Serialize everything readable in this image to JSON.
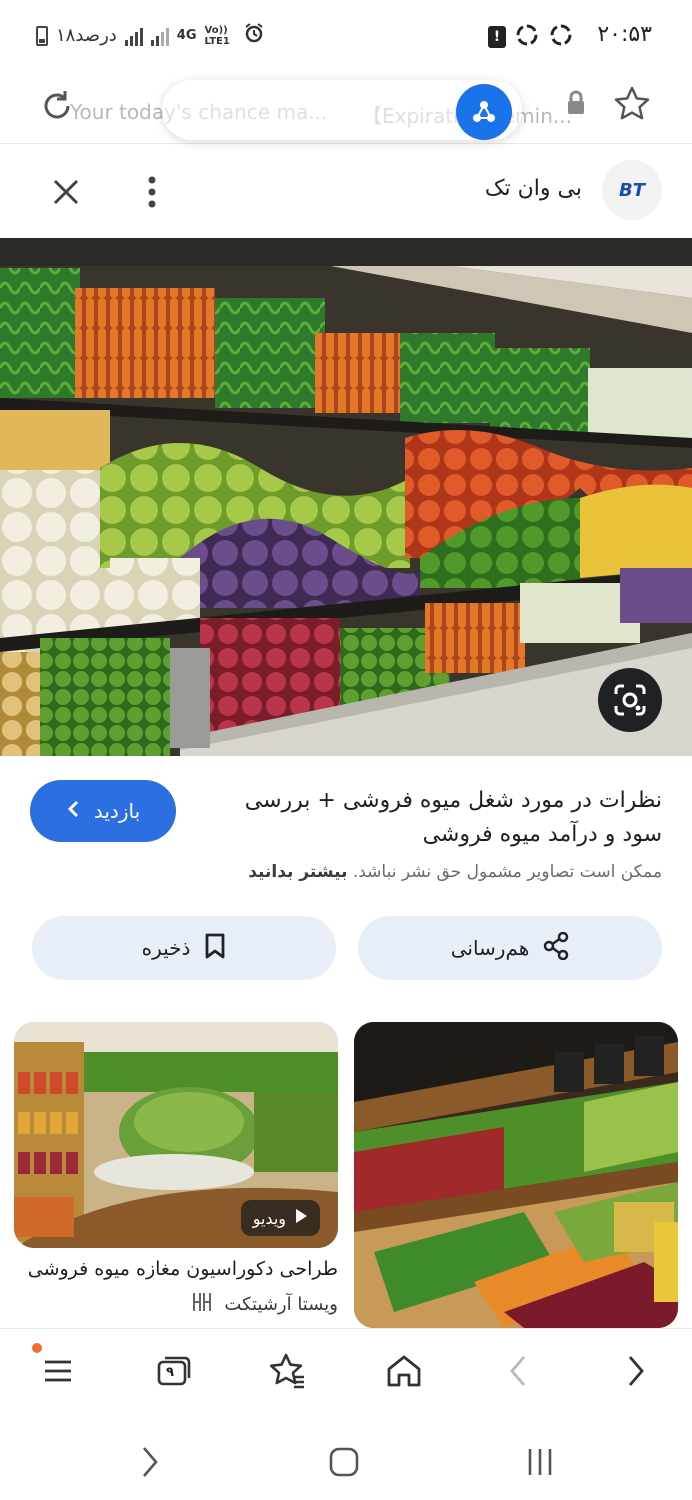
{
  "status_bar": {
    "time": "۲۰:۵۳",
    "battery_text": "۱۸درصد",
    "network": "4G",
    "volte": "Vo)) LTE1"
  },
  "urlbar": {
    "url_text": "Your today's chance ma...",
    "url_text_secondary": "【Expiration Remin..."
  },
  "site": {
    "name": "بی وان تک",
    "logo_text": "BT"
  },
  "result": {
    "title_line1": "نظرات در مورد شغل میوه فروشی + بررسی",
    "title_line2": "سود و درآمد میوه فروشی",
    "visit_label": "بازدید",
    "copyright_text": "ممکن است تصاویر مشمول حق نشر نباشد.",
    "learn_more": "بیشتر بدانید"
  },
  "actions": {
    "share_label": "هم‌رسانی",
    "save_label": "ذخیره"
  },
  "related": [
    {
      "title": "طراحی دکوراسیون مغازه میوه فروشی",
      "source": "ویستا آرشیتکت",
      "badge": "ویدیو"
    }
  ],
  "toolbar": {
    "tab_count": "۹"
  },
  "colors": {
    "accent": "#2b6fe0",
    "chip_bg": "#e8eef8",
    "share_fab": "#1a73e8"
  }
}
